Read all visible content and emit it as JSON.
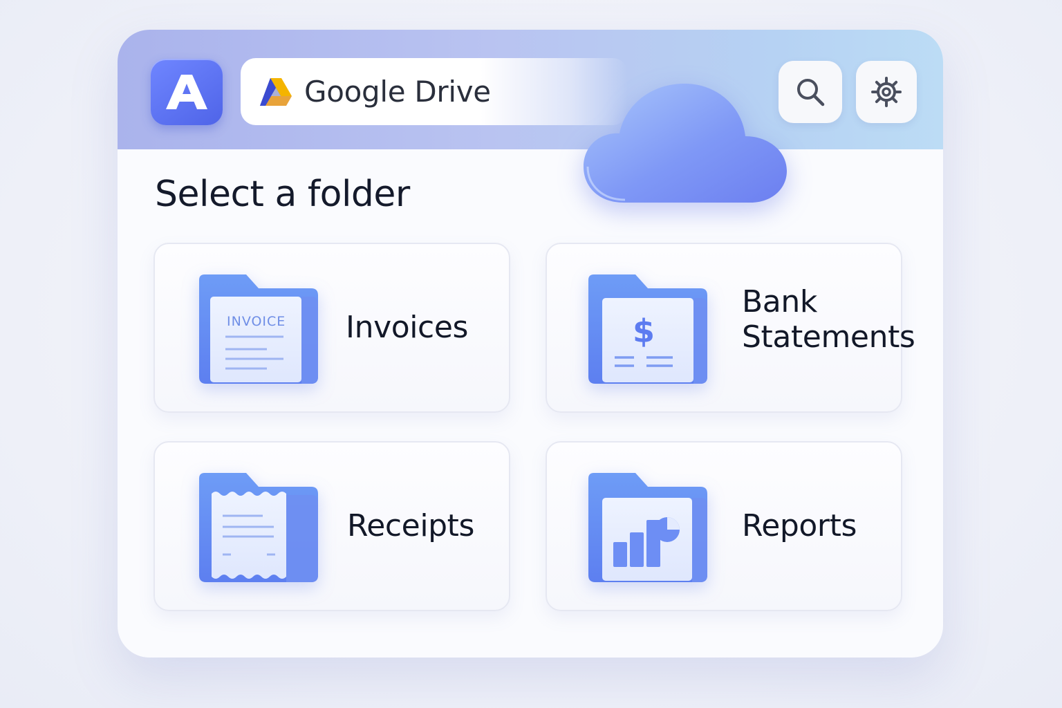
{
  "app": {
    "logo_letter": "A",
    "accent": "#5a70f0",
    "header_gradient": [
      "#aab3ec",
      "#bcdcf5"
    ]
  },
  "location": {
    "title": "Google Drive",
    "icon": "google-drive-icon"
  },
  "toolbar": {
    "search_icon": "search-icon",
    "settings_icon": "gear-icon"
  },
  "decoration": {
    "cloud_icon": "cloud-icon"
  },
  "page": {
    "title": "Select a folder"
  },
  "folders": [
    {
      "label": "Invoices",
      "icon": "invoice-folder-icon",
      "icon_text": "INVOICE"
    },
    {
      "label": "Bank Statements",
      "icon": "bank-statement-folder-icon",
      "icon_text": "$"
    },
    {
      "label": "Receipts",
      "icon": "receipt-folder-icon"
    },
    {
      "label": "Reports",
      "icon": "report-folder-icon"
    }
  ]
}
